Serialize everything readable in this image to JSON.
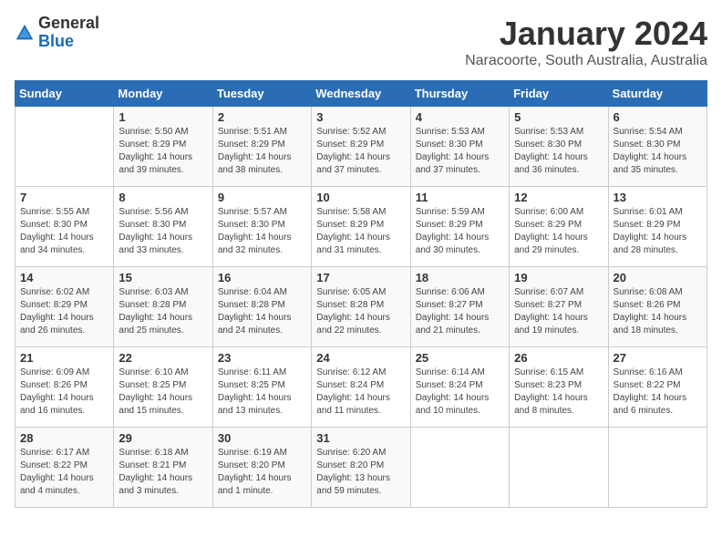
{
  "header": {
    "logo_general": "General",
    "logo_blue": "Blue",
    "month": "January 2024",
    "location": "Naracoorte, South Australia, Australia"
  },
  "days_of_week": [
    "Sunday",
    "Monday",
    "Tuesday",
    "Wednesday",
    "Thursday",
    "Friday",
    "Saturday"
  ],
  "weeks": [
    [
      {
        "day": "",
        "content": ""
      },
      {
        "day": "1",
        "content": "Sunrise: 5:50 AM\nSunset: 8:29 PM\nDaylight: 14 hours\nand 39 minutes."
      },
      {
        "day": "2",
        "content": "Sunrise: 5:51 AM\nSunset: 8:29 PM\nDaylight: 14 hours\nand 38 minutes."
      },
      {
        "day": "3",
        "content": "Sunrise: 5:52 AM\nSunset: 8:29 PM\nDaylight: 14 hours\nand 37 minutes."
      },
      {
        "day": "4",
        "content": "Sunrise: 5:53 AM\nSunset: 8:30 PM\nDaylight: 14 hours\nand 37 minutes."
      },
      {
        "day": "5",
        "content": "Sunrise: 5:53 AM\nSunset: 8:30 PM\nDaylight: 14 hours\nand 36 minutes."
      },
      {
        "day": "6",
        "content": "Sunrise: 5:54 AM\nSunset: 8:30 PM\nDaylight: 14 hours\nand 35 minutes."
      }
    ],
    [
      {
        "day": "7",
        "content": "Sunrise: 5:55 AM\nSunset: 8:30 PM\nDaylight: 14 hours\nand 34 minutes."
      },
      {
        "day": "8",
        "content": "Sunrise: 5:56 AM\nSunset: 8:30 PM\nDaylight: 14 hours\nand 33 minutes."
      },
      {
        "day": "9",
        "content": "Sunrise: 5:57 AM\nSunset: 8:30 PM\nDaylight: 14 hours\nand 32 minutes."
      },
      {
        "day": "10",
        "content": "Sunrise: 5:58 AM\nSunset: 8:29 PM\nDaylight: 14 hours\nand 31 minutes."
      },
      {
        "day": "11",
        "content": "Sunrise: 5:59 AM\nSunset: 8:29 PM\nDaylight: 14 hours\nand 30 minutes."
      },
      {
        "day": "12",
        "content": "Sunrise: 6:00 AM\nSunset: 8:29 PM\nDaylight: 14 hours\nand 29 minutes."
      },
      {
        "day": "13",
        "content": "Sunrise: 6:01 AM\nSunset: 8:29 PM\nDaylight: 14 hours\nand 28 minutes."
      }
    ],
    [
      {
        "day": "14",
        "content": "Sunrise: 6:02 AM\nSunset: 8:29 PM\nDaylight: 14 hours\nand 26 minutes."
      },
      {
        "day": "15",
        "content": "Sunrise: 6:03 AM\nSunset: 8:28 PM\nDaylight: 14 hours\nand 25 minutes."
      },
      {
        "day": "16",
        "content": "Sunrise: 6:04 AM\nSunset: 8:28 PM\nDaylight: 14 hours\nand 24 minutes."
      },
      {
        "day": "17",
        "content": "Sunrise: 6:05 AM\nSunset: 8:28 PM\nDaylight: 14 hours\nand 22 minutes."
      },
      {
        "day": "18",
        "content": "Sunrise: 6:06 AM\nSunset: 8:27 PM\nDaylight: 14 hours\nand 21 minutes."
      },
      {
        "day": "19",
        "content": "Sunrise: 6:07 AM\nSunset: 8:27 PM\nDaylight: 14 hours\nand 19 minutes."
      },
      {
        "day": "20",
        "content": "Sunrise: 6:08 AM\nSunset: 8:26 PM\nDaylight: 14 hours\nand 18 minutes."
      }
    ],
    [
      {
        "day": "21",
        "content": "Sunrise: 6:09 AM\nSunset: 8:26 PM\nDaylight: 14 hours\nand 16 minutes."
      },
      {
        "day": "22",
        "content": "Sunrise: 6:10 AM\nSunset: 8:25 PM\nDaylight: 14 hours\nand 15 minutes."
      },
      {
        "day": "23",
        "content": "Sunrise: 6:11 AM\nSunset: 8:25 PM\nDaylight: 14 hours\nand 13 minutes."
      },
      {
        "day": "24",
        "content": "Sunrise: 6:12 AM\nSunset: 8:24 PM\nDaylight: 14 hours\nand 11 minutes."
      },
      {
        "day": "25",
        "content": "Sunrise: 6:14 AM\nSunset: 8:24 PM\nDaylight: 14 hours\nand 10 minutes."
      },
      {
        "day": "26",
        "content": "Sunrise: 6:15 AM\nSunset: 8:23 PM\nDaylight: 14 hours\nand 8 minutes."
      },
      {
        "day": "27",
        "content": "Sunrise: 6:16 AM\nSunset: 8:22 PM\nDaylight: 14 hours\nand 6 minutes."
      }
    ],
    [
      {
        "day": "28",
        "content": "Sunrise: 6:17 AM\nSunset: 8:22 PM\nDaylight: 14 hours\nand 4 minutes."
      },
      {
        "day": "29",
        "content": "Sunrise: 6:18 AM\nSunset: 8:21 PM\nDaylight: 14 hours\nand 3 minutes."
      },
      {
        "day": "30",
        "content": "Sunrise: 6:19 AM\nSunset: 8:20 PM\nDaylight: 14 hours\nand 1 minute."
      },
      {
        "day": "31",
        "content": "Sunrise: 6:20 AM\nSunset: 8:20 PM\nDaylight: 13 hours\nand 59 minutes."
      },
      {
        "day": "",
        "content": ""
      },
      {
        "day": "",
        "content": ""
      },
      {
        "day": "",
        "content": ""
      }
    ]
  ]
}
